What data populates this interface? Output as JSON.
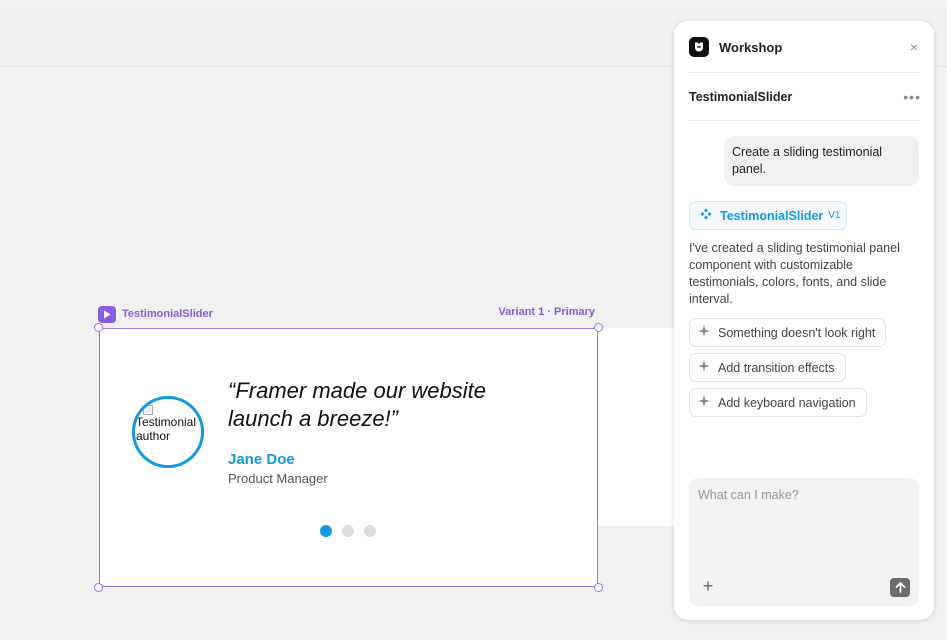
{
  "canvas": {
    "frame_label": "TestimonialSlider",
    "variant_label": "Variant 1 · Primary",
    "testimonial": {
      "quote": "“Framer made our website launch a breeze!”",
      "author": "Jane Doe",
      "role": "Product Manager",
      "avatar_alt": "Testimonial author",
      "slide_count": 3,
      "active_slide": 1
    }
  },
  "panel": {
    "title": "Workshop",
    "close_label": "×",
    "component_name": "TestimonialSlider",
    "more_label": "•••",
    "user_message": "Create a sliding testimonial panel.",
    "chip": {
      "name": "TestimonialSlider",
      "version": "V1"
    },
    "reply": "I've created a sliding testimonial panel component with customizable testimonials, colors, fonts, and slide interval.",
    "suggestions": [
      "Something doesn't look right",
      "Add transition effects",
      "Add keyboard navigation"
    ],
    "prompt_placeholder": "What can I make?",
    "add_label": "+"
  },
  "colors": {
    "accent": "#1598e0",
    "frame": "#9b74e0",
    "frame_label": "#8a5cdb"
  }
}
